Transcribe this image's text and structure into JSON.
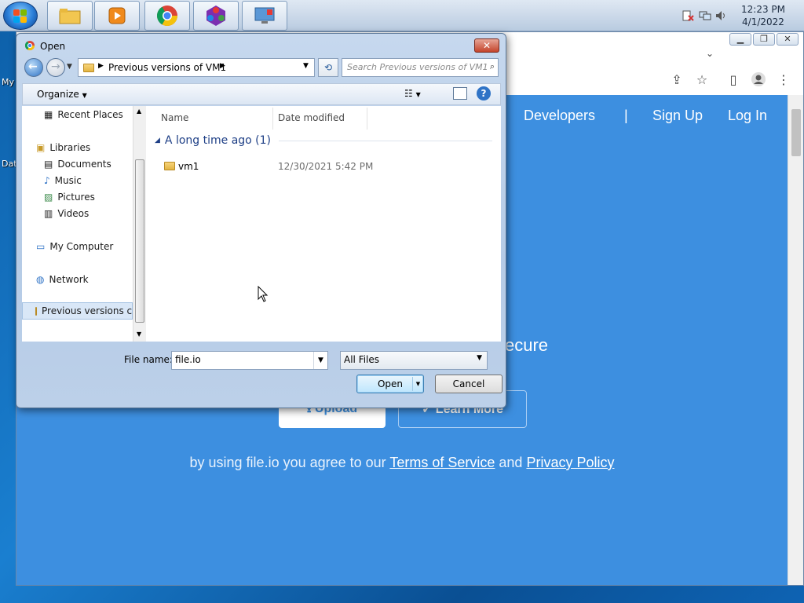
{
  "taskbar": {
    "apps": [
      {
        "name": "file-explorer"
      },
      {
        "name": "media-player"
      },
      {
        "name": "chrome"
      },
      {
        "name": "app-colorful"
      },
      {
        "name": "remote-desktop"
      }
    ],
    "clock": {
      "time": "12:23 PM",
      "date": "4/1/2022"
    }
  },
  "desktop": {
    "labels": [
      "My",
      "Dat"
    ]
  },
  "browser": {
    "nav": {
      "developers": "Developers",
      "separator": "|",
      "signup": "Sign Up",
      "login": "Log In"
    },
    "hero": {
      "partial_text": "ecure",
      "upload": "Upload",
      "learn_more": "Learn More"
    },
    "agree": {
      "prefix": "by using file.io you agree to our ",
      "terms": "Terms of Service",
      "and": " and ",
      "privacy": "Privacy Policy"
    }
  },
  "dialog": {
    "title": "Open",
    "address": {
      "segment": "Previous versions of VM1"
    },
    "search_placeholder": "Search Previous versions of VM1",
    "organize": "Organize",
    "nav_pane": {
      "recent_places": "Recent Places",
      "libraries": "Libraries",
      "documents": "Documents",
      "music": "Music",
      "pictures": "Pictures",
      "videos": "Videos",
      "my_computer": "My Computer",
      "network": "Network",
      "previous_versions": "Previous versions c"
    },
    "columns": {
      "name": "Name",
      "date_modified": "Date modified"
    },
    "group": {
      "label": "A long time ago (1)"
    },
    "files": [
      {
        "name": "vm1",
        "date": "12/30/2021 5:42 PM"
      }
    ],
    "file_name_label": "File name:",
    "file_name_value": "file.io",
    "file_type": "All Files",
    "open_button": "Open",
    "cancel_button": "Cancel"
  }
}
